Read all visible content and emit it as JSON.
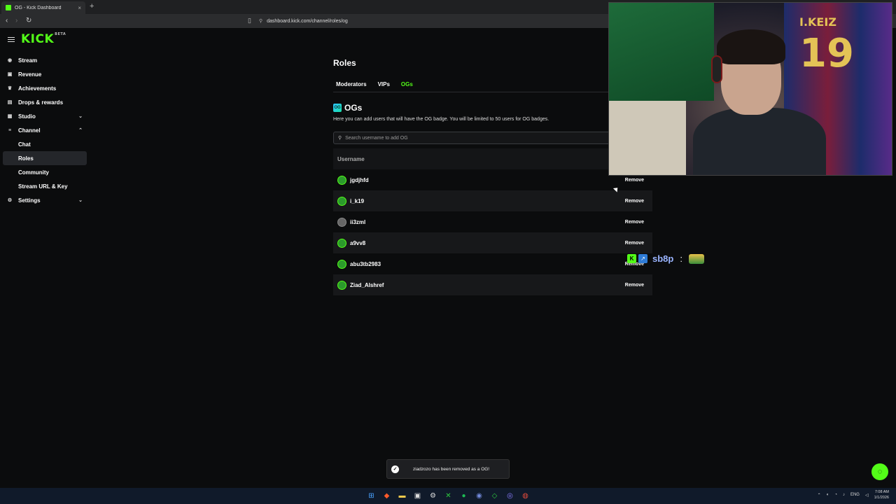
{
  "browser": {
    "tab_title": "OG - Kick Dashboard",
    "tab_close": "×",
    "new_tab": "+",
    "url": "dashboard.kick.com/channel/roles/og"
  },
  "brand": {
    "logo": "KICK",
    "logo_tag": "BETA"
  },
  "sidebar": {
    "items": [
      {
        "label": "Stream",
        "icon": "stream-icon",
        "glyph": "((•))"
      },
      {
        "label": "Revenue",
        "icon": "revenue-icon",
        "glyph": "▣"
      },
      {
        "label": "Achievements",
        "icon": "trophy-icon",
        "glyph": "♛"
      },
      {
        "label": "Drops & rewards",
        "icon": "gift-icon",
        "glyph": "▤"
      },
      {
        "label": "Studio",
        "icon": "studio-icon",
        "glyph": "▦",
        "chevron": "⌄"
      },
      {
        "label": "Channel",
        "icon": "channel-icon",
        "glyph": "≡",
        "chevron": "⌃"
      }
    ],
    "channel_sub": [
      {
        "label": "Chat"
      },
      {
        "label": "Roles"
      },
      {
        "label": "Community"
      },
      {
        "label": "Stream URL & Key"
      }
    ],
    "settings": {
      "label": "Settings",
      "icon": "gear-icon",
      "glyph": "⚙",
      "chevron": "⌄"
    }
  },
  "main": {
    "title": "Roles",
    "tabs": [
      {
        "label": "Moderators"
      },
      {
        "label": "VIPs"
      },
      {
        "label": "OGs"
      }
    ],
    "section_title": "OGs",
    "section_badge": "OG",
    "description": "Here you can add users that will have the OG badge. You will be limited to 50 users for OG badges.",
    "search_placeholder": "Search username to add OG",
    "table_header": "Username",
    "remove_label": "Remove",
    "rows": [
      {
        "username": "jgdjhfd"
      },
      {
        "username": "i_k19"
      },
      {
        "username": "ii3zml"
      },
      {
        "username": "a9vv8"
      },
      {
        "username": "abu3tb2983"
      },
      {
        "username": "Ziad_Alshref"
      }
    ]
  },
  "overlay": {
    "chat_user": "sb8p",
    "chat_colon": ":",
    "jersey_name": "I.KEIZ",
    "jersey_number": "19"
  },
  "toast": {
    "message": "ziadzozo has been removed as a OG!"
  },
  "taskbar": {
    "lang": "ENG",
    "time": "7:08 AM",
    "date": "1/1/2026"
  },
  "colors": {
    "accent": "#53fc18",
    "background": "#0b0c0d"
  }
}
